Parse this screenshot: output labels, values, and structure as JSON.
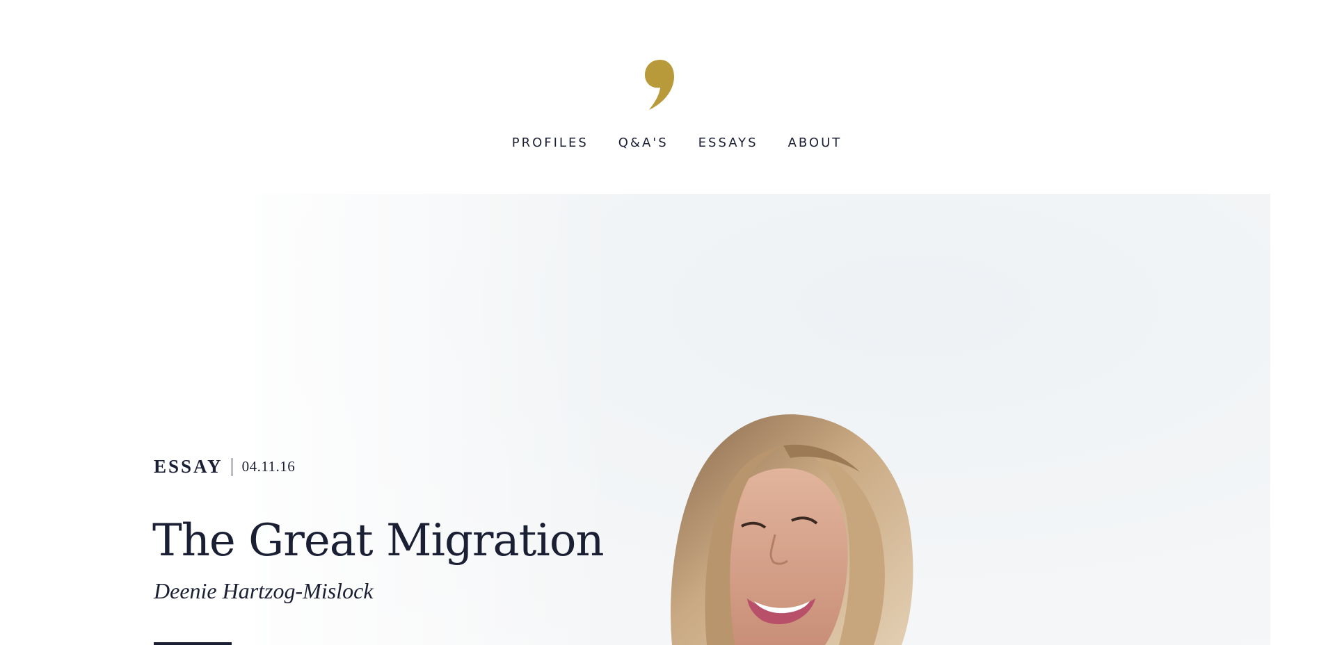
{
  "site": {
    "logo_icon": "comma-logo-icon",
    "logo_color": "#b89a3a"
  },
  "nav": {
    "items": [
      {
        "label": "PROFILES"
      },
      {
        "label": "Q&A'S"
      },
      {
        "label": "ESSAYS"
      },
      {
        "label": "ABOUT"
      }
    ]
  },
  "hero": {
    "image_icon": "portrait-photo",
    "category": "ESSAY",
    "date": "04.11.16",
    "title": "The Great Migration",
    "author": "Deenie Hartzog-Mislock"
  },
  "colors": {
    "text": "#1b1f33",
    "accent": "#b89a3a",
    "background": "#ffffff"
  }
}
